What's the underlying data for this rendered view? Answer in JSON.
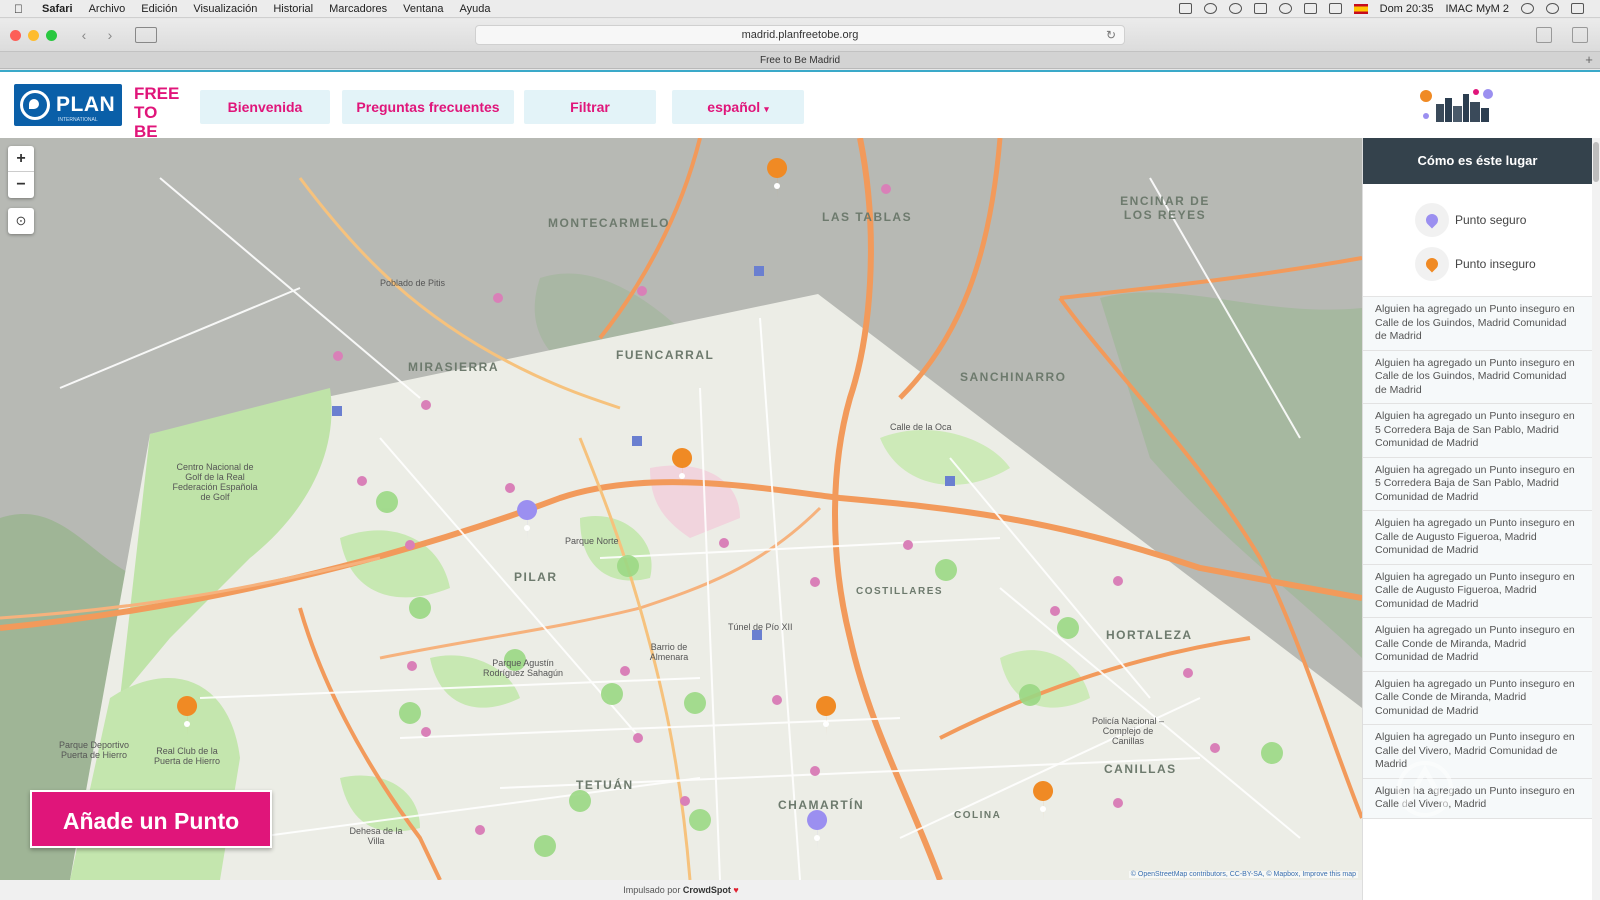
{
  "menubar": {
    "app_name": "Safari",
    "items": [
      "Archivo",
      "Edición",
      "Visualización",
      "Historial",
      "Marcadores",
      "Ventana",
      "Ayuda"
    ],
    "clock": "Dom 20:35",
    "user": "IMAC MyM 2"
  },
  "browser": {
    "url": "madrid.planfreetobe.org",
    "tab_title": "Free to Be Madrid"
  },
  "header": {
    "logo_text": "PLAN",
    "logo_subtext": "INTERNATIONAL",
    "free_to_be": "FREE TO BE",
    "nav": [
      {
        "label": "Bienvenida"
      },
      {
        "label": "Preguntas frecuentes"
      },
      {
        "label": "Filtrar"
      },
      {
        "label": "español"
      }
    ]
  },
  "map": {
    "add_point_label": "Añade un Punto",
    "zoom_in": "+",
    "zoom_out": "−",
    "locate_icon": "target-icon",
    "attribution": "© OpenStreetMap contributors, CC-BY-SA, © Mapbox, Improve this map",
    "district_labels": [
      "MONTECARMELO",
      "LAS TABLAS",
      "ENCINAR DE LOS REYES",
      "MIRASIERRA",
      "FUENCARRAL",
      "SANCHINARRO",
      "PILAR",
      "COSTILLARES",
      "HORTALEZA",
      "TETUÁN",
      "CHAMARTÍN",
      "CANILLAS",
      "COLINA"
    ],
    "place_labels": [
      "Poblado de Pitis",
      "Centro Nacional de Golf de la Real Federación Española de Golf",
      "Parque Norte",
      "Real Club de la Puerta de Hierro",
      "Dehesa de la Villa",
      "Parque Agustín Rodríguez Sahagún",
      "Barrio de Almenara",
      "Túnel de Pío XII",
      "Policía Nacional – Complejo de Canillas",
      "Parque Deportivo Puerta de Hierro",
      "Calle de la Oca"
    ]
  },
  "footer": {
    "powered_by": "Impulsado por",
    "brand": "CrowdSpot"
  },
  "panel": {
    "title": "Cómo es éste lugar",
    "legend": [
      {
        "label": "Punto seguro",
        "color": "#9b8ff0"
      },
      {
        "label": "Punto inseguro",
        "color": "#f08a24"
      }
    ],
    "feed": [
      "Alguien ha agregado un Punto inseguro en Calle de los Guindos, Madrid Comunidad de Madrid",
      "Alguien ha agregado un Punto inseguro en Calle de los Guindos, Madrid Comunidad de Madrid",
      "Alguien ha agregado un Punto inseguro en 5 Corredera Baja de San Pablo, Madrid Comunidad de Madrid",
      "Alguien ha agregado un Punto inseguro en 5 Corredera Baja de San Pablo, Madrid Comunidad de Madrid",
      "Alguien ha agregado un Punto inseguro en Calle de Augusto Figueroa, Madrid Comunidad de Madrid",
      "Alguien ha agregado un Punto inseguro en Calle de Augusto Figueroa, Madrid Comunidad de Madrid",
      "Alguien ha agregado un Punto inseguro en Calle Conde de Miranda, Madrid Comunidad de Madrid",
      "Alguien ha agregado un Punto inseguro en Calle Conde de Miranda, Madrid Comunidad de Madrid",
      "Alguien ha agregado un Punto inseguro en Calle del Vivero, Madrid Comunidad de Madrid",
      "Alguien ha agregado un Punto inseguro en Calle del Vivero, Madrid"
    ]
  },
  "colors": {
    "brand_pink": "#e0157a",
    "brand_blue": "#0a5fa8",
    "panel_header": "#34424c",
    "safe_pin": "#9b8ff0",
    "unsafe_pin": "#f08a24"
  }
}
